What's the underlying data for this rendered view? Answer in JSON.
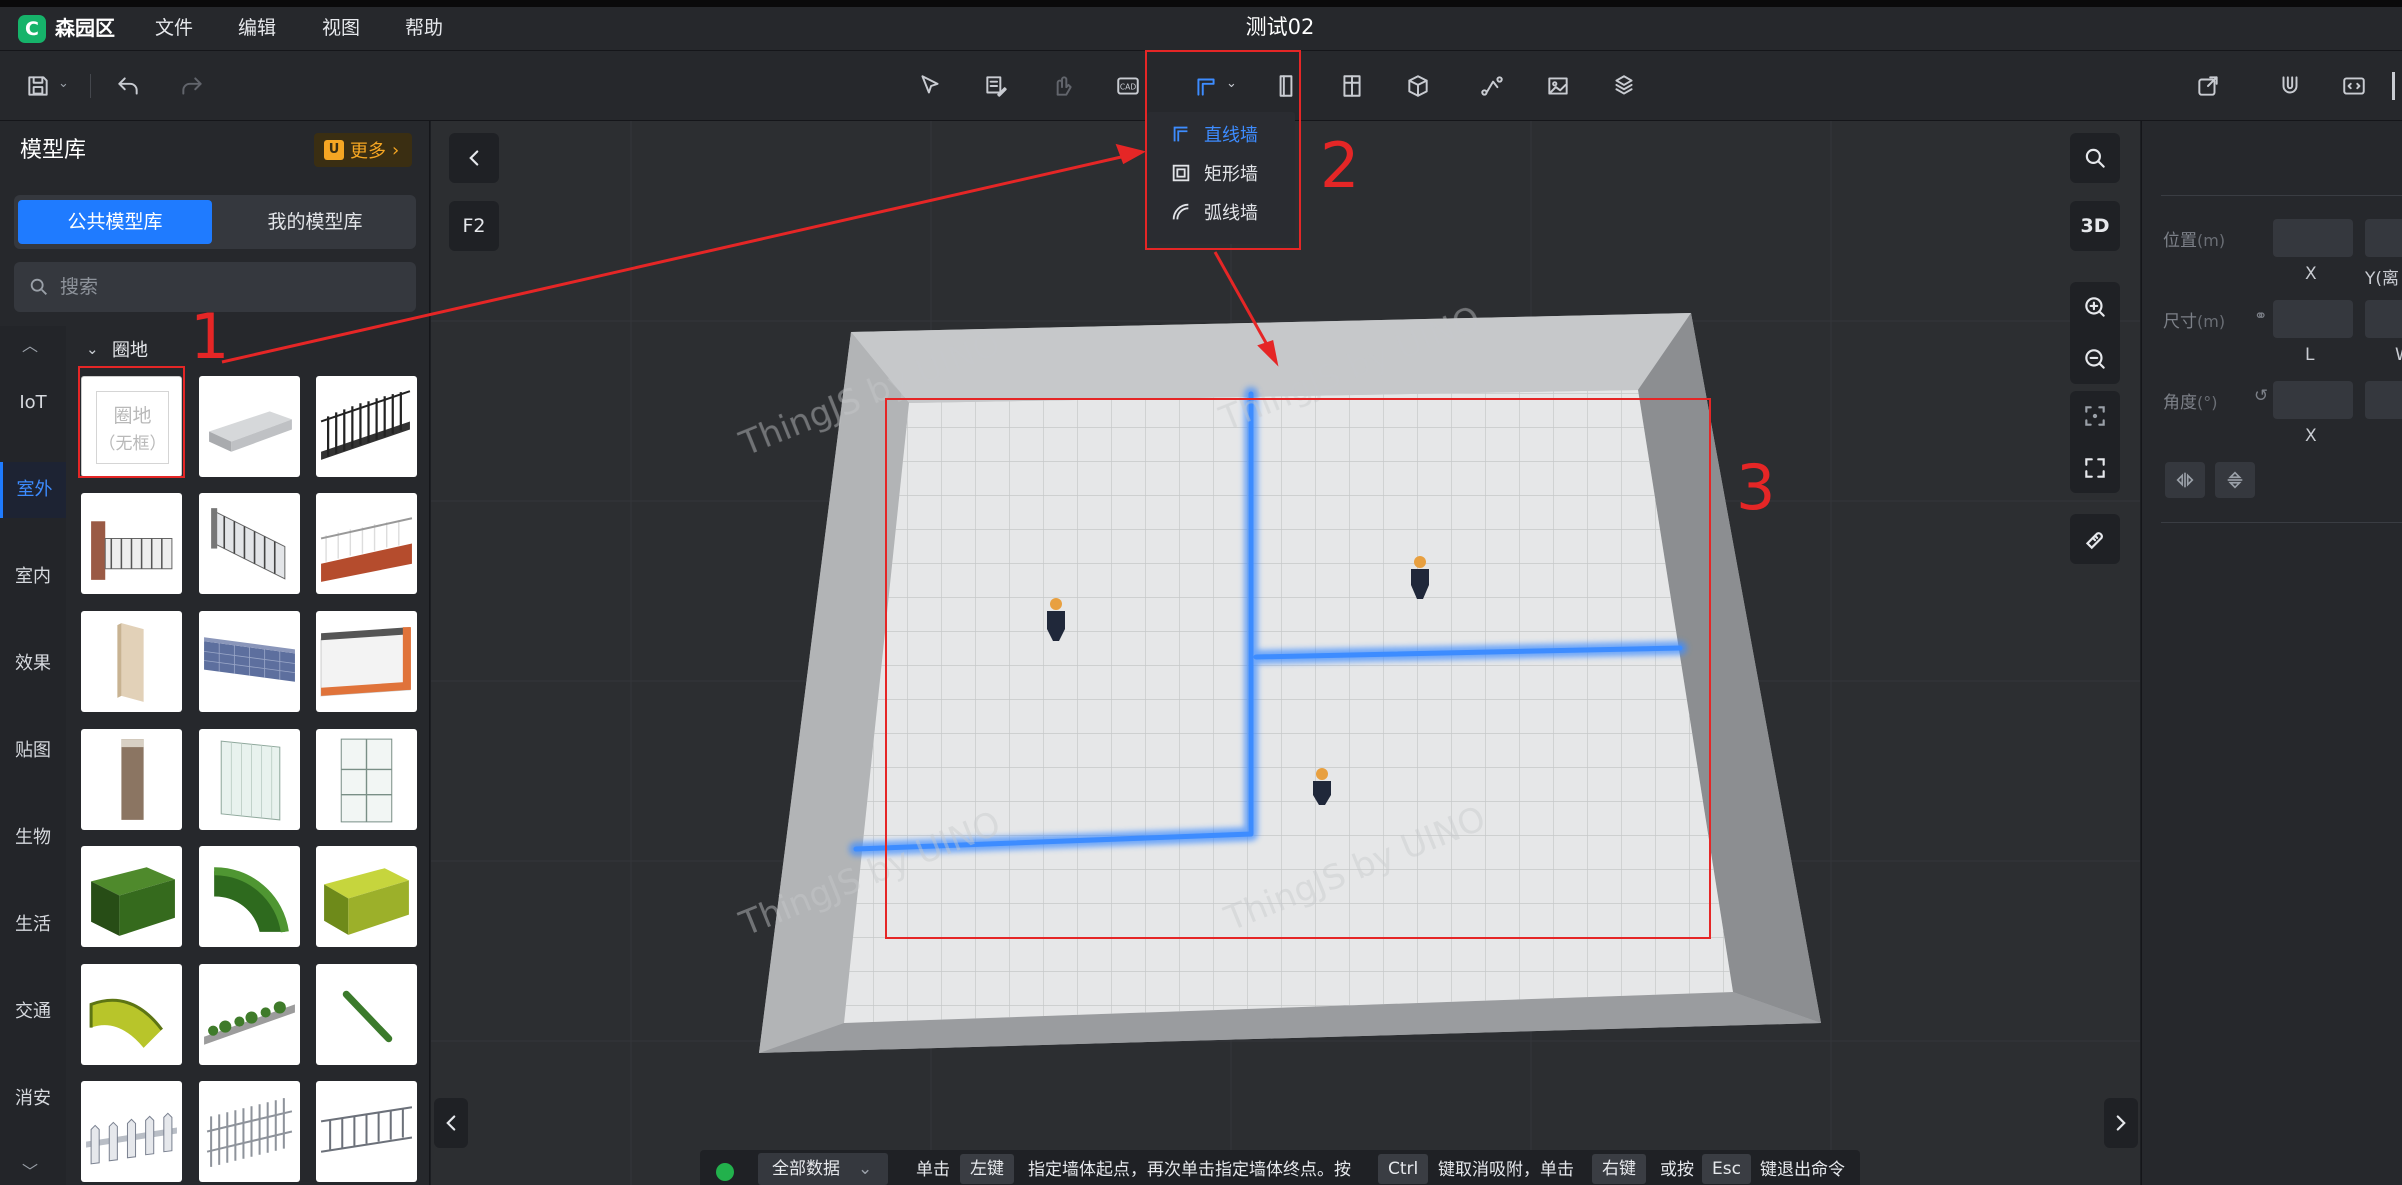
{
  "app": {
    "name": "森园区",
    "doc_title": "测试02",
    "accent": "#1f7bff",
    "brand": "#16b36a"
  },
  "menu": [
    "文件",
    "编辑",
    "视图",
    "帮助"
  ],
  "wall_menu": {
    "items": [
      "直线墙",
      "矩形墙",
      "弧线墙"
    ],
    "selected": "直线墙"
  },
  "library": {
    "title": "模型库",
    "more": "更多",
    "tabs": [
      "公共模型库",
      "我的模型库"
    ],
    "active_tab": "公共模型库",
    "search_placeholder": "搜索",
    "categories": [
      "IoT",
      "室外",
      "室内",
      "效果",
      "贴图",
      "生物",
      "生活",
      "交通",
      "消安"
    ],
    "active_category": "室外",
    "group": "圈地",
    "first_thumb_text": [
      "圈地",
      "（无框）"
    ]
  },
  "viewport": {
    "f2": "F2",
    "view3d": "3D",
    "watermark": "ThingJS by UINO"
  },
  "status": {
    "data_select": "全部数据",
    "parts": [
      "单击",
      "左键",
      "指定墙体起点，再次单击指定墙体终点。按",
      "Ctrl",
      "键取消吸附，单击",
      "右键",
      "或按",
      "Esc",
      "键退出命令"
    ]
  },
  "props": {
    "position": "位置",
    "size": "尺寸",
    "angle": "角度",
    "unit_m": "(m)",
    "unit_deg": "(°)",
    "x": "X",
    "y_far": "Y(离",
    "l": "L",
    "w": "W"
  },
  "annotations": [
    "1",
    "2",
    "3"
  ]
}
